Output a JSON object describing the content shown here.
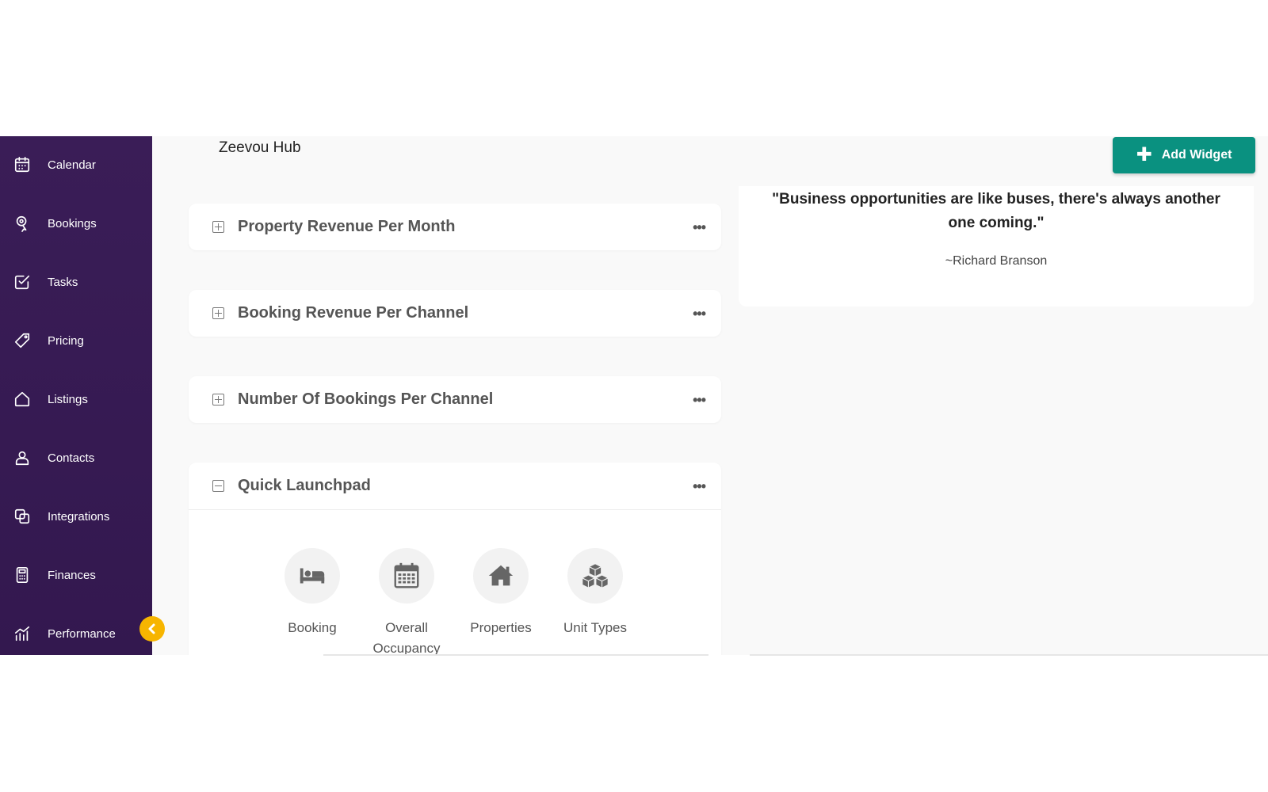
{
  "sidebar": {
    "items": [
      {
        "label": "Calendar",
        "icon": "calendar-icon"
      },
      {
        "label": "Bookings",
        "icon": "bookings-icon"
      },
      {
        "label": "Tasks",
        "icon": "tasks-icon"
      },
      {
        "label": "Pricing",
        "icon": "pricing-tag-icon"
      },
      {
        "label": "Listings",
        "icon": "listings-home-icon"
      },
      {
        "label": "Contacts",
        "icon": "contacts-user-icon"
      },
      {
        "label": "Integrations",
        "icon": "integrations-icon"
      },
      {
        "label": "Finances",
        "icon": "finances-calculator-icon"
      },
      {
        "label": "Performance",
        "icon": "performance-chart-icon"
      }
    ],
    "collapse_icon": "chevron-left-icon"
  },
  "header": {
    "title": "Zeevou Hub",
    "add_widget_label": "Add Widget"
  },
  "widgets": [
    {
      "title": "Property Revenue Per Month",
      "state": "collapsed"
    },
    {
      "title": "Booking Revenue Per Channel",
      "state": "collapsed"
    },
    {
      "title": "Number Of Bookings Per Channel",
      "state": "collapsed"
    },
    {
      "title": "Quick Launchpad",
      "state": "expanded"
    }
  ],
  "launchpad": {
    "items": [
      {
        "label": "Booking",
        "icon": "bed-icon"
      },
      {
        "label": "Overall Occupancy",
        "icon": "calendar-grid-icon"
      },
      {
        "label": "Properties",
        "icon": "house-icon"
      },
      {
        "label": "Unit Types",
        "icon": "cubes-icon"
      }
    ]
  },
  "quote": {
    "text": "\"Business opportunities are like buses, there's always another one coming.\"",
    "author": "~Richard Branson"
  },
  "colors": {
    "sidebar": "#3a1d57",
    "accent": "#0a9180",
    "collapse": "#f7b500"
  }
}
